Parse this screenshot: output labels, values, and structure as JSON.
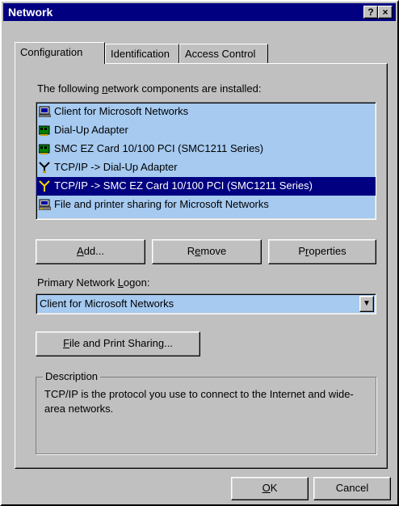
{
  "window": {
    "title": "Network",
    "help_button": "?",
    "close_button": "×"
  },
  "tabs": [
    {
      "label": "Configuration",
      "active": true
    },
    {
      "label": "Identification",
      "active": false
    },
    {
      "label": "Access Control",
      "active": false
    }
  ],
  "components": {
    "heading_prefix": "The following ",
    "heading_accel": "n",
    "heading_suffix": "etwork components are installed:",
    "items": [
      {
        "label": "Client for Microsoft Networks",
        "icon": "client-icon",
        "selected": false
      },
      {
        "label": "Dial-Up Adapter",
        "icon": "adapter-icon",
        "selected": false
      },
      {
        "label": "SMC EZ Card 10/100 PCI (SMC1211 Series)",
        "icon": "adapter-icon",
        "selected": false
      },
      {
        "label": "TCP/IP -> Dial-Up Adapter",
        "icon": "protocol-icon",
        "selected": false
      },
      {
        "label": "TCP/IP -> SMC EZ Card 10/100 PCI (SMC1211 Series)",
        "icon": "protocol-icon",
        "selected": true
      },
      {
        "label": "File and printer sharing for Microsoft Networks",
        "icon": "service-icon",
        "selected": false
      }
    ]
  },
  "buttons": {
    "add_accel": "A",
    "add_rest": "dd...",
    "remove_pre": "R",
    "remove_accel": "e",
    "remove_rest": "move",
    "properties_pre": "P",
    "properties_accel": "r",
    "properties_rest": "operties",
    "file_sharing_accel": "F",
    "file_sharing_rest": "ile and Print Sharing...",
    "ok_accel": "O",
    "ok_rest": "K",
    "cancel": "Cancel"
  },
  "logon": {
    "label_pre": "Primary Network ",
    "label_accel": "L",
    "label_rest": "ogon:",
    "selected": "Client for Microsoft Networks",
    "dropdown_icon": "chevron-down-icon"
  },
  "description": {
    "title": "Description",
    "text": "TCP/IP is the protocol you use to connect to the Internet and wide-area networks."
  },
  "colors": {
    "titlebar": "#000080",
    "selection": "#000080",
    "list_background": "#a6caf0",
    "face": "#c0c0c0"
  }
}
